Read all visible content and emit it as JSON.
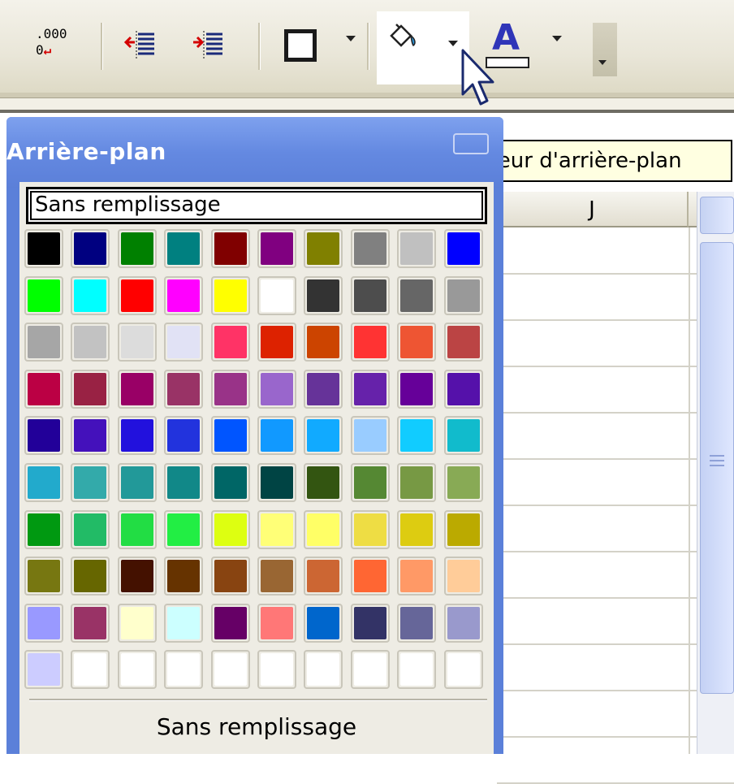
{
  "toolbar": {
    "decimal_line1": ".000",
    "decimal_line2": "0",
    "font_color_letter": "A",
    "buttons": [
      {
        "name": "reduce-decimal-icon"
      },
      {
        "name": "decrease-indent-icon"
      },
      {
        "name": "increase-indent-icon"
      },
      {
        "name": "borders-icon"
      },
      {
        "name": "fill-color-icon"
      },
      {
        "name": "font-color-icon"
      }
    ]
  },
  "tooltip": {
    "text": "Couleur d'arrière-plan"
  },
  "sheet": {
    "column_header": "J"
  },
  "panel": {
    "title": "Arrière-plan",
    "none_top": "Sans remplissage",
    "none_bottom": "Sans remplissage",
    "swatches": [
      [
        "#000000",
        "#000080",
        "#008000",
        "#008080",
        "#800000",
        "#800080",
        "#808000",
        "#808080",
        "#c0c0c0",
        "#0000ff"
      ],
      [
        "#00ff00",
        "#00ffff",
        "#ff0000",
        "#ff00ff",
        "#ffff00",
        "#ffffff",
        "#333333",
        "#4d4d4d",
        "#666666",
        "#999999"
      ],
      [
        "#a6a6a6",
        "#c2c2c2",
        "#dcdcdc",
        "#e1e2f5",
        "#ff3366",
        "#dd2200",
        "#cc4400",
        "#ff3333",
        "#ee5533",
        "#bb4444"
      ],
      [
        "#bb0044",
        "#992244",
        "#990066",
        "#993366",
        "#993388",
        "#9966cc",
        "#663399",
        "#6622aa",
        "#660099",
        "#5511aa"
      ],
      [
        "#220099",
        "#4411bb",
        "#2211dd",
        "#2233dd",
        "#0055ff",
        "#1199ff",
        "#11aaff",
        "#99ccff",
        "#11ccff",
        "#11bbcc"
      ],
      [
        "#22aacc",
        "#33aaaa",
        "#229999",
        "#118888",
        "#006666",
        "#004444",
        "#335511",
        "#558833",
        "#779944",
        "#88aa55"
      ],
      [
        "#009911",
        "#22bb66",
        "#22dd44",
        "#22ee44",
        "#ddff11",
        "#ffff77",
        "#ffff66",
        "#eedd44",
        "#ddcc11",
        "#bbaa00"
      ],
      [
        "#777711",
        "#666600",
        "#441100",
        "#663300",
        "#884411",
        "#996633",
        "#cc6633",
        "#ff6633",
        "#ff9966",
        "#ffcc99"
      ],
      [
        "#9999ff",
        "#993366",
        "#ffffcc",
        "#ccffff",
        "#660066",
        "#ff7777",
        "#0066cc",
        "#333366",
        "#666699",
        "#9999cc"
      ],
      [
        "#ccccff",
        "#ffffff",
        "#ffffff",
        "#ffffff",
        "#ffffff",
        "#ffffff",
        "#ffffff",
        "#ffffff",
        "#ffffff",
        "#ffffff"
      ]
    ]
  }
}
